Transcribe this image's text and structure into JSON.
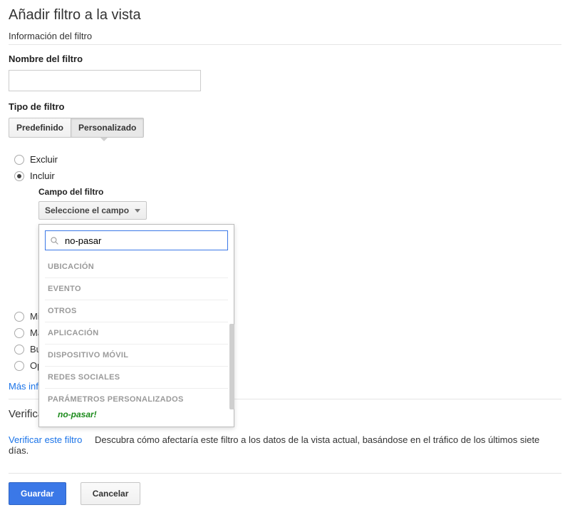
{
  "page": {
    "title": "Añadir filtro a la vista",
    "info_heading": "Información del filtro"
  },
  "filter_name": {
    "label": "Nombre del filtro",
    "value": ""
  },
  "filter_type": {
    "label": "Tipo de filtro",
    "options": {
      "predefined": "Predefinido",
      "custom": "Personalizado"
    },
    "selected": "custom"
  },
  "mode_radios": {
    "exclude": "Excluir",
    "include": "Incluir",
    "selected": "include"
  },
  "filter_field": {
    "label": "Campo del filtro",
    "button": "Seleccione el campo",
    "search_value": "no-pasar",
    "groups": [
      "UBICACIÓN",
      "EVENTO",
      "OTROS",
      "APLICACIÓN",
      "DISPOSITIVO MÓVIL",
      "REDES SOCIALES",
      "PARÁMETROS PERSONALIZADOS"
    ],
    "match": "no-pasar!"
  },
  "hidden_radios": [
    "Mi",
    "Ma",
    "Bu",
    "Op"
  ],
  "links": {
    "more_info": "Más inf",
    "verify": "Verificar este filtro"
  },
  "verify": {
    "title": "Verificación de filtros",
    "description": "Descubra cómo afectaría este filtro a los datos de la vista actual, basándose en el tráfico de los últimos siete días."
  },
  "buttons": {
    "save": "Guardar",
    "cancel": "Cancelar"
  }
}
